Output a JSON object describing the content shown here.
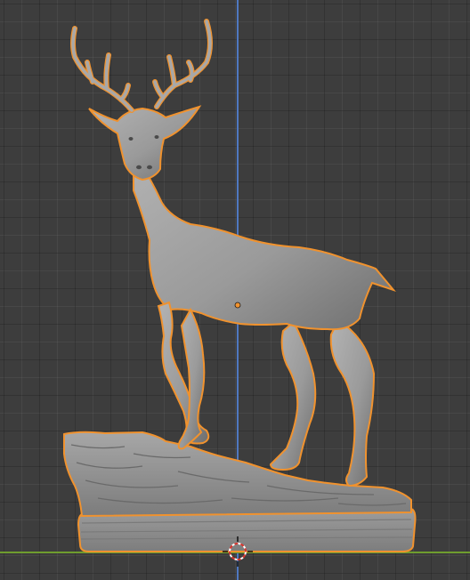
{
  "viewport": {
    "background_color": "#3d3d3d",
    "selection_outline_color": "#f0922e",
    "mesh_color": "#9b9b9b",
    "z_axis_color": "#4f78c0",
    "y_axis_color": "#6f9d2e"
  },
  "object": {
    "description_icon": "deer-statue-mesh",
    "selected": true,
    "origin_point_icon": "object-origin-dot"
  },
  "cursor": {
    "icon": "3d-cursor-icon"
  }
}
